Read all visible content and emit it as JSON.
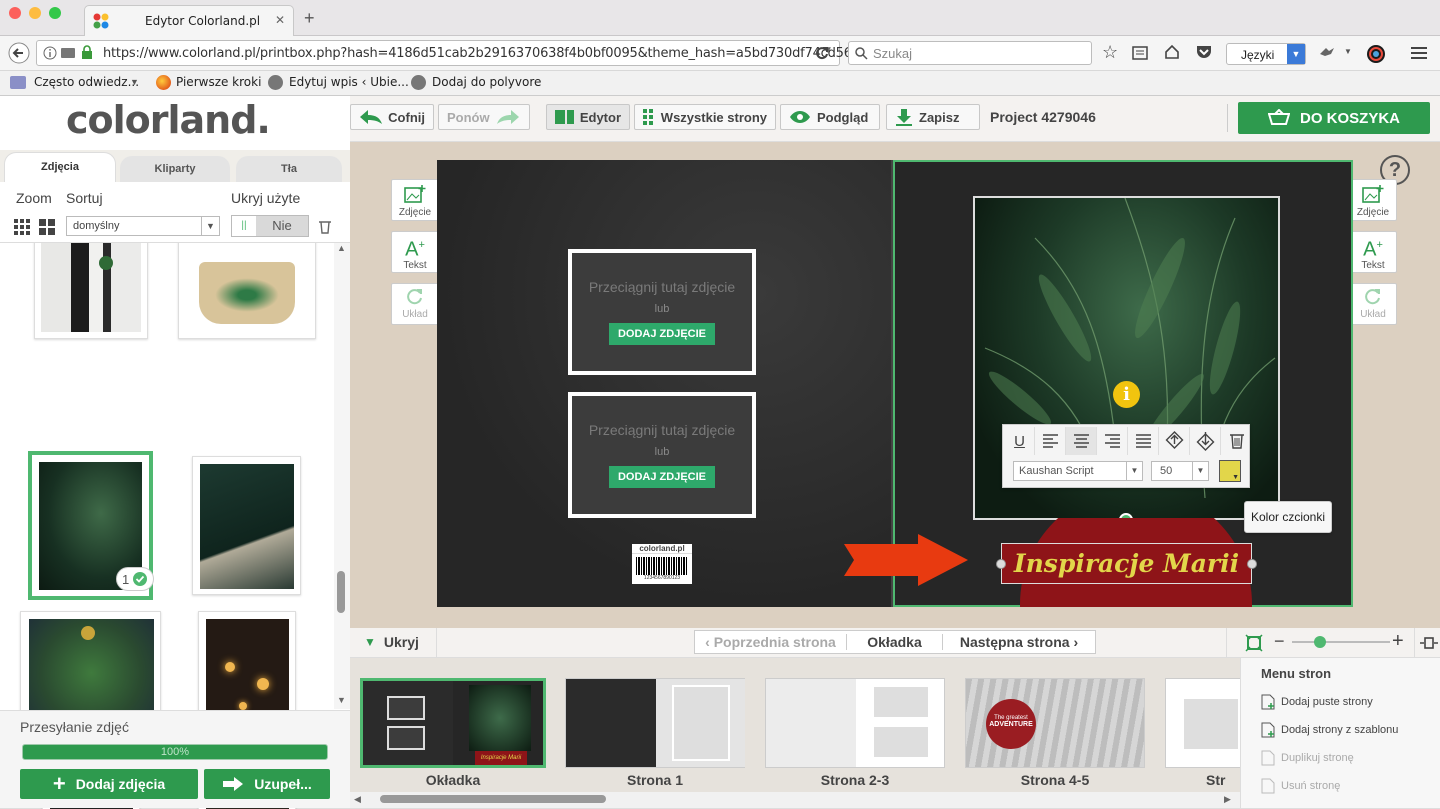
{
  "browser": {
    "tab_title": "Edytor Colorland.pl",
    "new_tab_glyph": "+",
    "close_glyph": "✕",
    "url": "https://www.colorland.pl/printbox.php?hash=4186d51cab2b2916370638f4b0bf0095&theme_hash=a5bd730df74cd56",
    "search_placeholder": "Szukaj",
    "language_label": "Języki",
    "bookmarks": [
      "Często odwiedz...",
      "Pierwsze kroki",
      "Edytuj wpis ‹ Ubie...",
      "Dodaj do polyvore"
    ]
  },
  "app": {
    "logo_text": "colorland.",
    "toolbar": {
      "undo_label": "Cofnij",
      "redo_label": "Ponów",
      "editor_label": "Edytor",
      "all_pages_label": "Wszystkie strony",
      "preview_label": "Podgląd",
      "save_label": "Zapisz",
      "project_label": "Project 4279046",
      "cart_label": "DO KOSZYKA"
    },
    "help_glyph": "?",
    "left_panel": {
      "tabs": [
        "Zdjęcia",
        "Kliparty",
        "Tła"
      ],
      "zoom_label": "Zoom",
      "sort_label": "Sortuj",
      "hide_used_label": "Ukryj użyte",
      "sort_value": "domyślny",
      "toggle_on": "||",
      "toggle_value": "Nie",
      "used_count": "1",
      "upload_label": "Przesyłanie zdjęć",
      "progress_text": "100%",
      "progress": 1.0,
      "add_photos_label": "Dodaj zdjęcia",
      "fill_label": "Uzupeł..."
    },
    "side_tools": {
      "photos": "Zdjęcie",
      "text": "Tekst",
      "layout": "Układ"
    },
    "placeholder": {
      "drag_text": "Przeciągnij tutaj zdjęcie",
      "or_text": "lub",
      "button_label": "DODAJ ZDJĘCIE"
    },
    "back_cover_logo": "colorland.pl",
    "barcode_number": "1234567890123",
    "text_toolbar": {
      "font": "Kaushan Script",
      "size": "50",
      "tooltip": "Kolor czcionki",
      "text_color": "#e2d64a"
    },
    "cover_title": "Inspiracje Marii",
    "nav": {
      "hide_label": "Ukryj",
      "prev_label": "Poprzednia strona",
      "current_label": "Okładka",
      "next_label": "Następna strona"
    },
    "zoom_controls": {
      "minus": "−",
      "plus": "+"
    },
    "pages": [
      "Okładka",
      "Strona 1",
      "Strona 2-3",
      "Strona 4-5",
      "Str"
    ],
    "thumb_badge_line1": "The greatest",
    "thumb_badge_line2": "ADVENTURE",
    "thumb_cover_title": "Inspiracje Marii",
    "pages_menu": {
      "title": "Menu stron",
      "items": [
        "Dodaj puste strony",
        "Dodaj strony z szablonu",
        "Duplikuj stronę",
        "Usuń stronę"
      ]
    },
    "colors": {
      "green": "#2e9a4e",
      "accent_green": "#4fb870",
      "cover_red": "#8e1418",
      "arrow_red": "#e83a10"
    }
  }
}
